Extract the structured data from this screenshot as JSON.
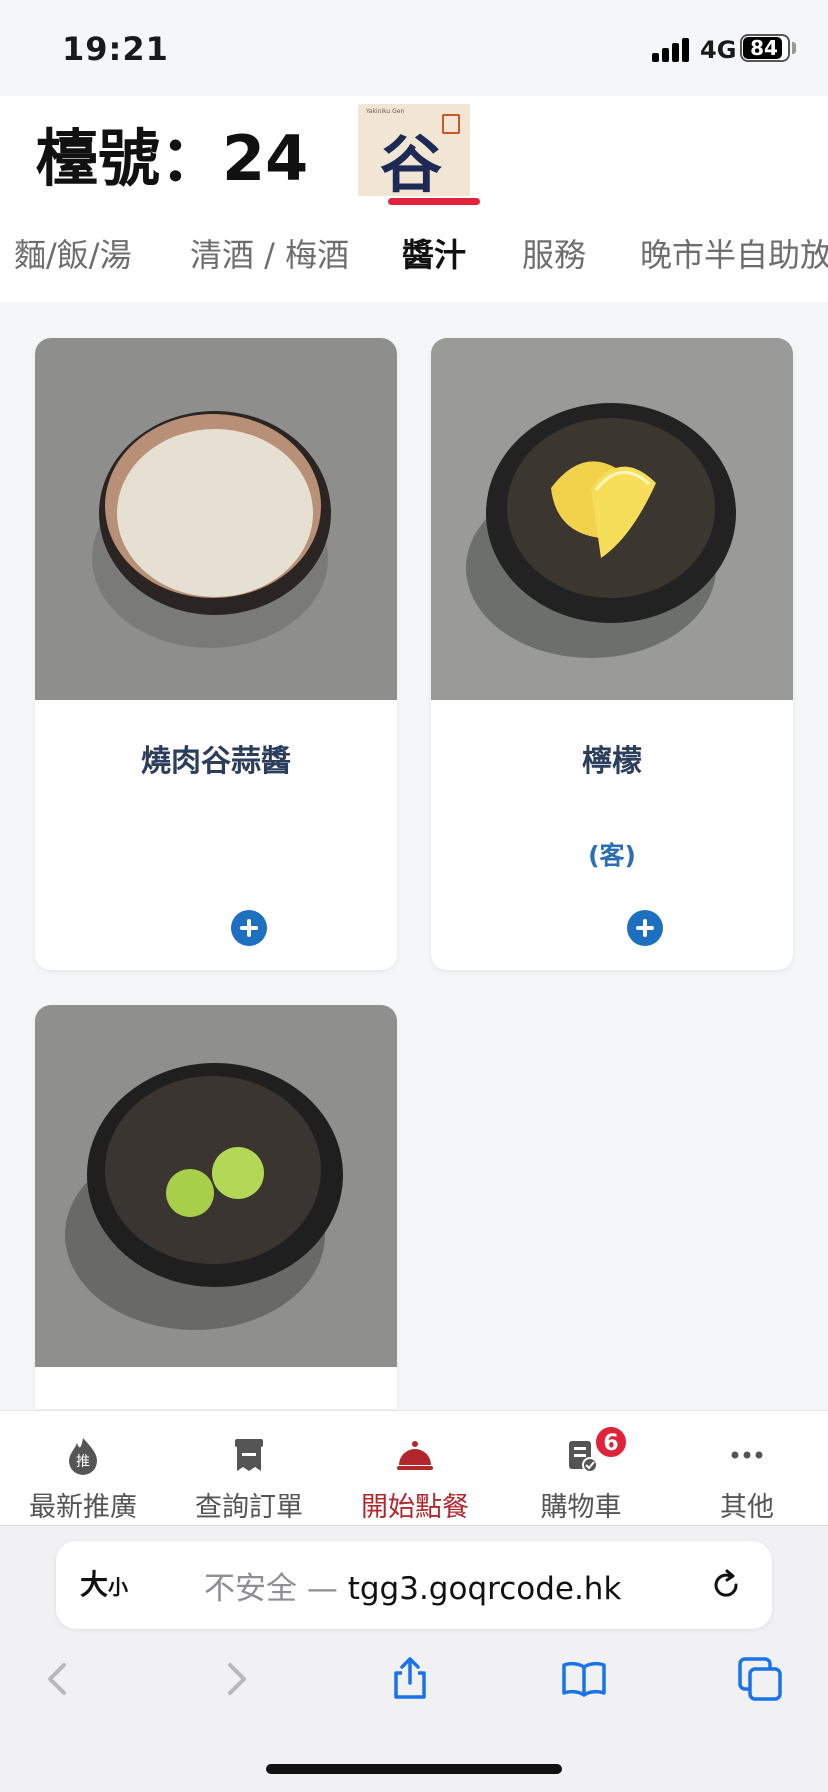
{
  "status_bar": {
    "time": "19:21",
    "network": "4G",
    "battery": "84"
  },
  "header": {
    "table_label": "檯號：24",
    "logo_glyph": "谷",
    "logo_text": "Yakiniku Gen"
  },
  "tabs": [
    {
      "label": "麵/飯/湯"
    },
    {
      "label": "清酒 / 梅酒"
    },
    {
      "label": "醬汁",
      "active": true
    },
    {
      "label": "服務"
    },
    {
      "label": "晚市半自助放題"
    }
  ],
  "items": [
    {
      "name": "燒肉谷蒜醬",
      "unit": ""
    },
    {
      "name": "檸檬",
      "unit": "(客)"
    },
    {
      "name": ""
    }
  ],
  "bottom_nav": [
    {
      "label": "最新推廣",
      "icon": "flame-icon",
      "icon_char": "推"
    },
    {
      "label": "查詢訂單",
      "icon": "receipt-icon"
    },
    {
      "label": "開始點餐",
      "icon": "food-cloche-icon",
      "active": true
    },
    {
      "label": "購物車",
      "icon": "cart-list-icon",
      "badge": "6"
    },
    {
      "label": "其他",
      "icon": "more-dots-icon"
    }
  ],
  "browser": {
    "text_size_label": "大",
    "text_size_small": "小",
    "url_insecure": "不安全 — ",
    "url_domain": "tgg3.goqrcode.hk"
  },
  "colors": {
    "accent": "#e0223a",
    "active_nav": "#b3262c",
    "add_button": "#1d6fc0"
  }
}
